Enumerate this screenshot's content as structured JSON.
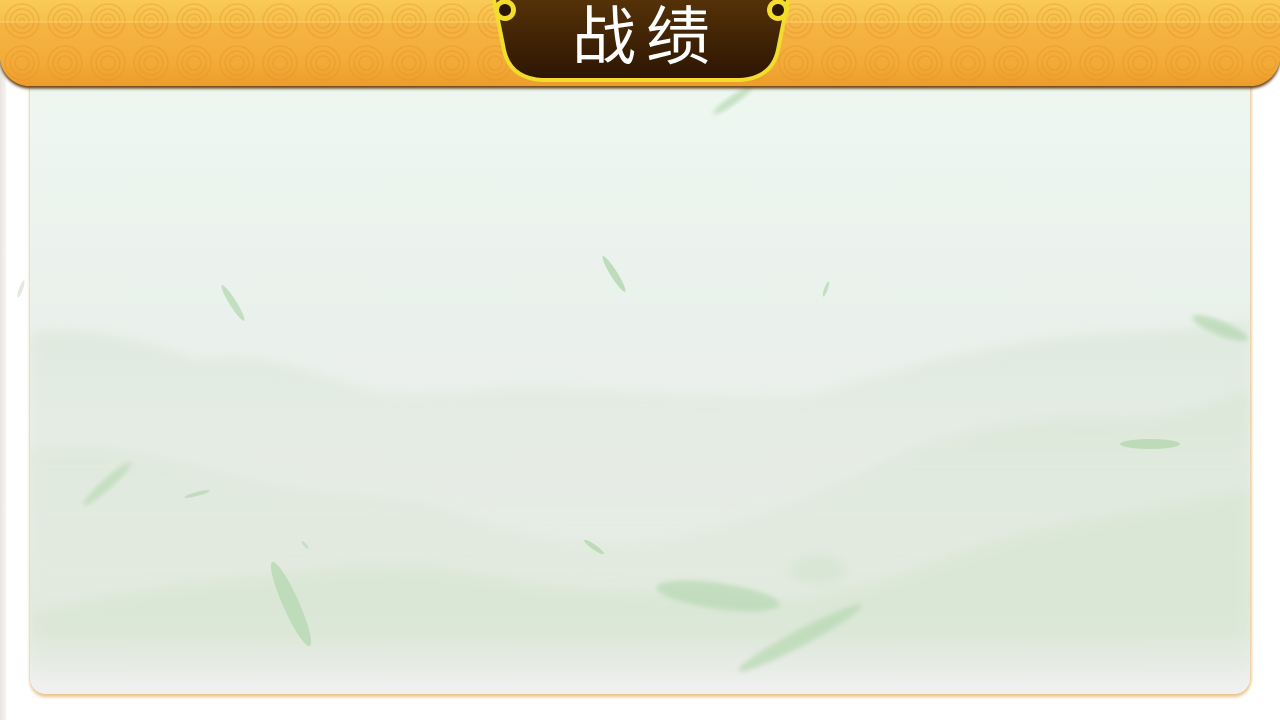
{
  "header": {
    "title": "战绩"
  },
  "colors": {
    "banner_top": "#f9cb56",
    "banner_bottom": "#ed9c2a",
    "plaque_fill": "#4a2a08",
    "plaque_border": "#f2dc2c",
    "panel_bg": "#eaf1ec",
    "leaf_green": "#b8d8b4"
  },
  "icons": {
    "plaque_left_rivet": "rivet-icon",
    "plaque_right_rivet": "rivet-icon"
  }
}
